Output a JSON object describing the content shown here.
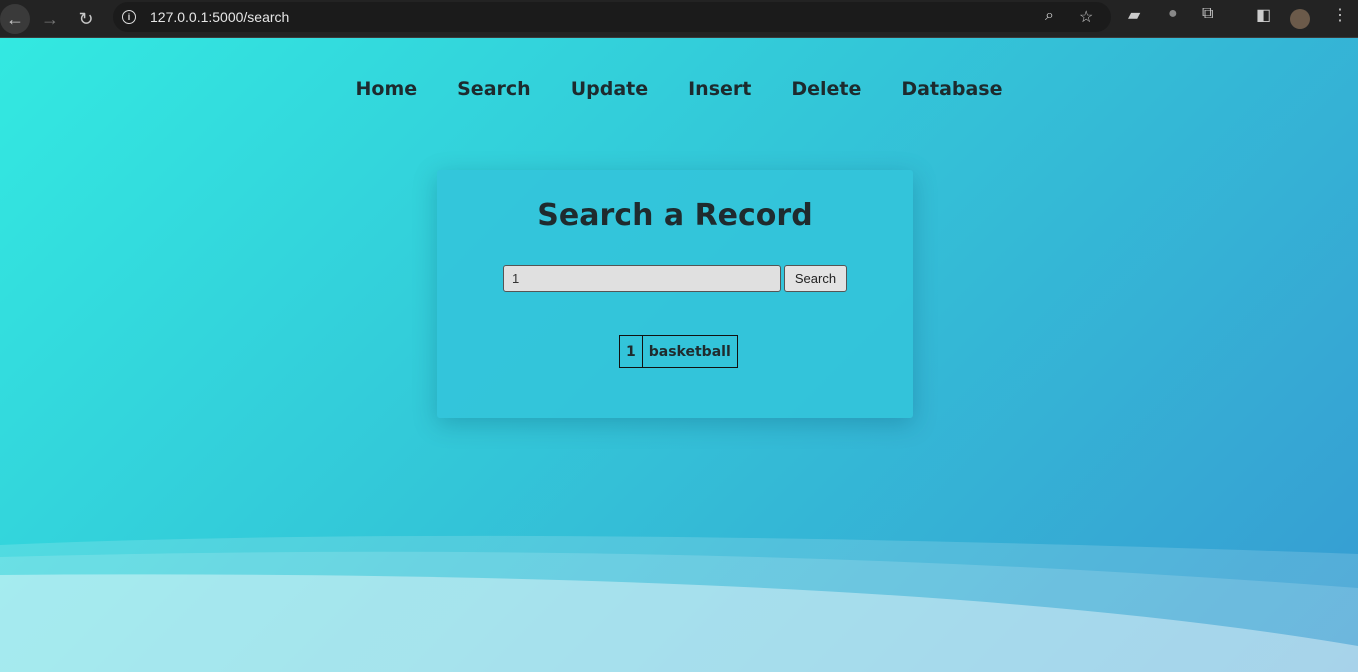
{
  "browser": {
    "url": "127.0.0.1:5000/search"
  },
  "nav": {
    "items": [
      "Home",
      "Search",
      "Update",
      "Insert",
      "Delete",
      "Database"
    ]
  },
  "card": {
    "title": "Search a Record",
    "input_value": "1",
    "button_label": "Search",
    "results": [
      [
        "1",
        "basketball"
      ]
    ]
  }
}
